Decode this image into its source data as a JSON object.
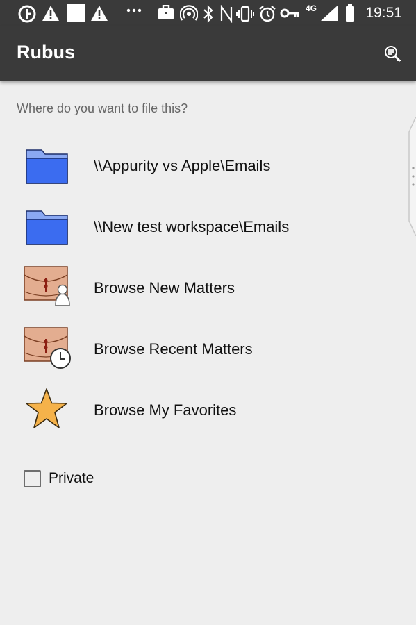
{
  "status_bar": {
    "time": "19:51",
    "network": "4G",
    "icons": [
      "g-icon",
      "warning-icon",
      "blank-square-icon",
      "warning-icon",
      "more-dots-icon",
      "briefcase-icon",
      "hotspot-icon",
      "bluetooth-icon",
      "nfc-icon",
      "vibrate-icon",
      "alarm-icon",
      "key-icon",
      "signal-icon",
      "battery-icon"
    ]
  },
  "app_bar": {
    "title": "Rubus",
    "action_icon": "queue-search-icon"
  },
  "prompt": "Where do you want to file this?",
  "items": [
    {
      "label": "\\\\Appurity vs Apple\\Emails",
      "icon": "folder-icon"
    },
    {
      "label": "\\\\New test workspace\\Emails",
      "icon": "folder-icon"
    },
    {
      "label": "Browse New Matters",
      "icon": "matter-new-icon"
    },
    {
      "label": "Browse Recent Matters",
      "icon": "matter-recent-icon"
    },
    {
      "label": "Browse My Favorites",
      "icon": "star-icon"
    }
  ],
  "private": {
    "label": "Private",
    "checked": false
  },
  "colors": {
    "bar": "#3a3a3a",
    "background": "#eeeeee",
    "folder": "#3b6cf0",
    "matter": "#e0a98a",
    "star": "#f5b24a"
  }
}
